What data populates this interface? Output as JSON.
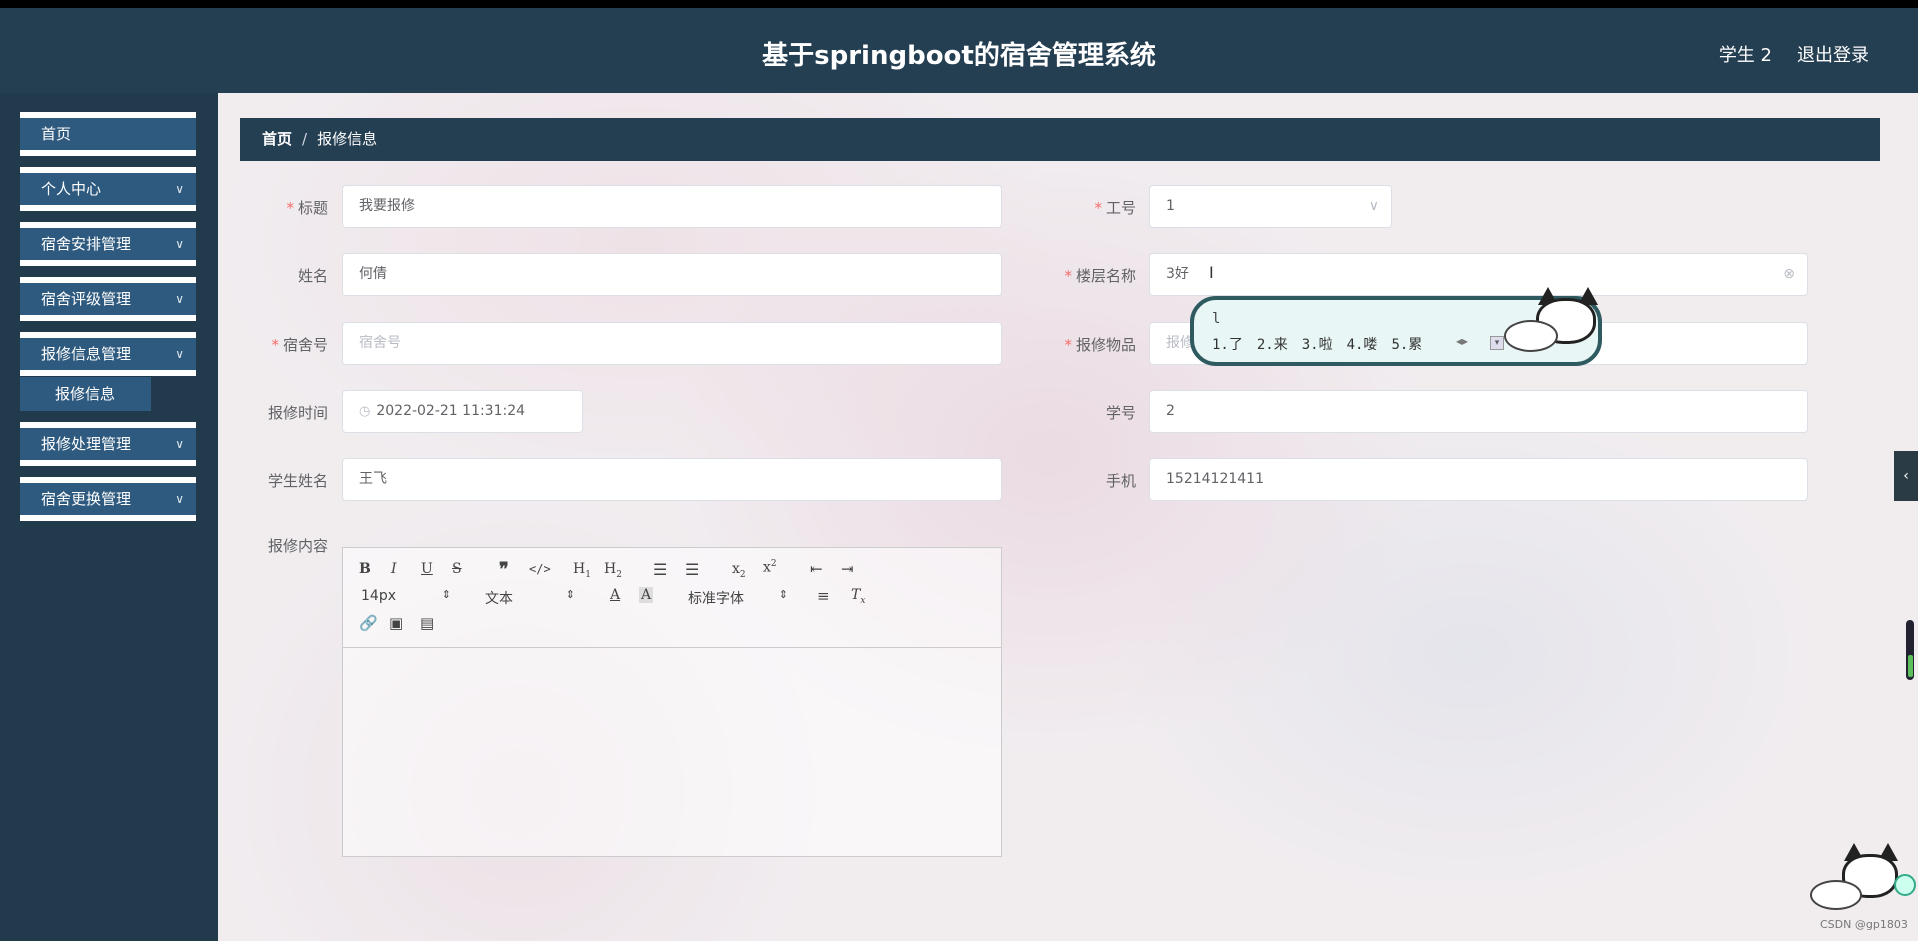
{
  "header": {
    "title": "基于springboot的宿舍管理系统",
    "user": "学生 2",
    "logout": "退出登录"
  },
  "sidebar": {
    "items": [
      {
        "label": "首页",
        "has_chevron": false
      },
      {
        "label": "个人中心",
        "has_chevron": true
      },
      {
        "label": "宿舍安排管理",
        "has_chevron": true
      },
      {
        "label": "宿舍评级管理",
        "has_chevron": true
      },
      {
        "label": "报修信息管理",
        "has_chevron": true
      },
      {
        "label": "报修处理管理",
        "has_chevron": true
      },
      {
        "label": "宿舍更换管理",
        "has_chevron": true
      }
    ],
    "submenu": {
      "label": "报修信息"
    }
  },
  "breadcrumb": {
    "home": "首页",
    "separator": "/",
    "current": "报修信息"
  },
  "form": {
    "title": {
      "label": "标题",
      "value": "我要报修",
      "required": true
    },
    "work_no": {
      "label": "工号",
      "value": "1",
      "required": true
    },
    "name": {
      "label": "姓名",
      "value": "何倩",
      "required": false
    },
    "floor_name": {
      "label": "楼层名称",
      "value": "3好",
      "required": true
    },
    "dorm_no": {
      "label": "宿舍号",
      "placeholder": "宿舍号",
      "required": true
    },
    "repair_item": {
      "label": "报修物品",
      "placeholder": "报修",
      "required": true
    },
    "repair_time": {
      "label": "报修时间",
      "value": "2022-02-21 11:31:24",
      "required": false
    },
    "student_no": {
      "label": "学号",
      "value": "2",
      "required": false
    },
    "student_name": {
      "label": "学生姓名",
      "value": "王飞",
      "required": false
    },
    "phone": {
      "label": "手机",
      "value": "15214121411",
      "required": false
    },
    "content": {
      "label": "报修内容"
    }
  },
  "editor": {
    "font_size": "14px",
    "paragraph": "文本",
    "font_family": "标准字体"
  },
  "ime": {
    "typed": "l",
    "candidates": [
      "1.了",
      "2.来",
      "3.啦",
      "4.喽",
      "5.累"
    ]
  },
  "watermark": "CSDN @gp1803",
  "colors": {
    "header_bg": "#243e52",
    "menu_bg": "#2f5a7f",
    "required": "#f56c6c"
  }
}
